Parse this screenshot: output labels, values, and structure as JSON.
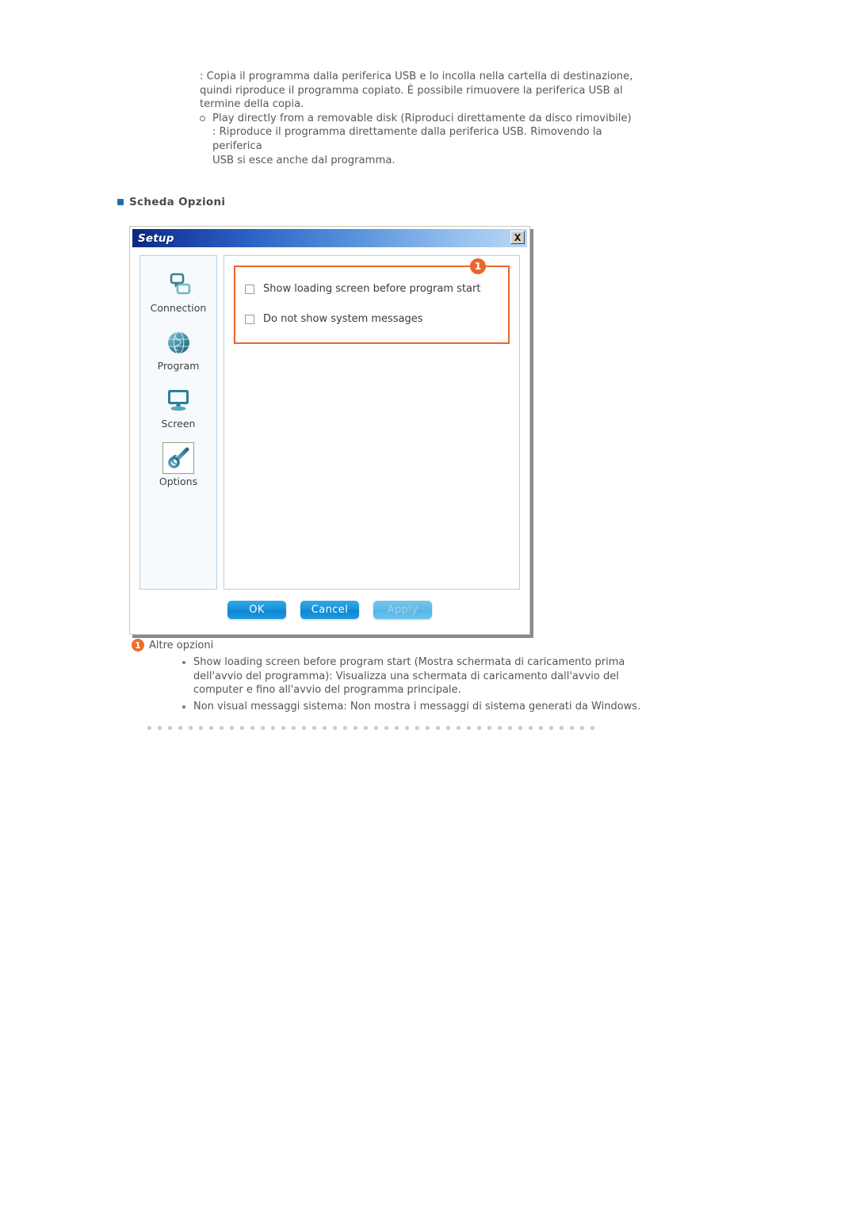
{
  "intro": {
    "paragraph_lines": [
      ": Copia il programma dalla periferica USB e lo incolla nella cartella di destinazione,",
      "quindi riproduce il programma copiato. È possibile rimuovere la periferica USB al",
      "termine della copia."
    ],
    "bullet_title": "Play directly from a removable disk (Riproduci direttamente da disco rimovibile)",
    "bullet_lines": [
      ": Riproduce il programma direttamente dalla periferica USB. Rimovendo la periferica",
      "USB si esce anche dal programma."
    ]
  },
  "section": {
    "title": "Scheda Opzioni",
    "bullet_color": "#1a6fb4"
  },
  "dialog": {
    "title": "Setup",
    "close_label": "×",
    "nav": {
      "items": [
        {
          "label": "Connection",
          "icon": "connection-icon",
          "selected": false
        },
        {
          "label": "Program",
          "icon": "globe-icon",
          "selected": false
        },
        {
          "label": "Screen",
          "icon": "monitor-icon",
          "selected": false
        },
        {
          "label": "Options",
          "icon": "wrench-icon",
          "selected": true
        }
      ]
    },
    "options": {
      "callout_badge": "1",
      "callout_color": "#e8662a",
      "checkboxes": [
        {
          "label": "Show loading screen before program start",
          "checked": false
        },
        {
          "label": "Do not show system messages",
          "checked": false
        }
      ]
    },
    "buttons": [
      {
        "label": "OK",
        "state": "enabled"
      },
      {
        "label": "Cancel",
        "state": "enabled"
      },
      {
        "label": "Apply",
        "state": "disabled"
      }
    ]
  },
  "legend": {
    "badge": "1",
    "heading": "Altre opzioni",
    "items": [
      "Show loading screen before program start (Mostra schermata di caricamento prima dell'avvio del programma): Visualizza una schermata di caricamento dall'avvio del computer e fino all'avvio del programma principale.",
      "Non visual messaggi sistema: Non mostra i messaggi di sistema generati da Windows."
    ]
  }
}
